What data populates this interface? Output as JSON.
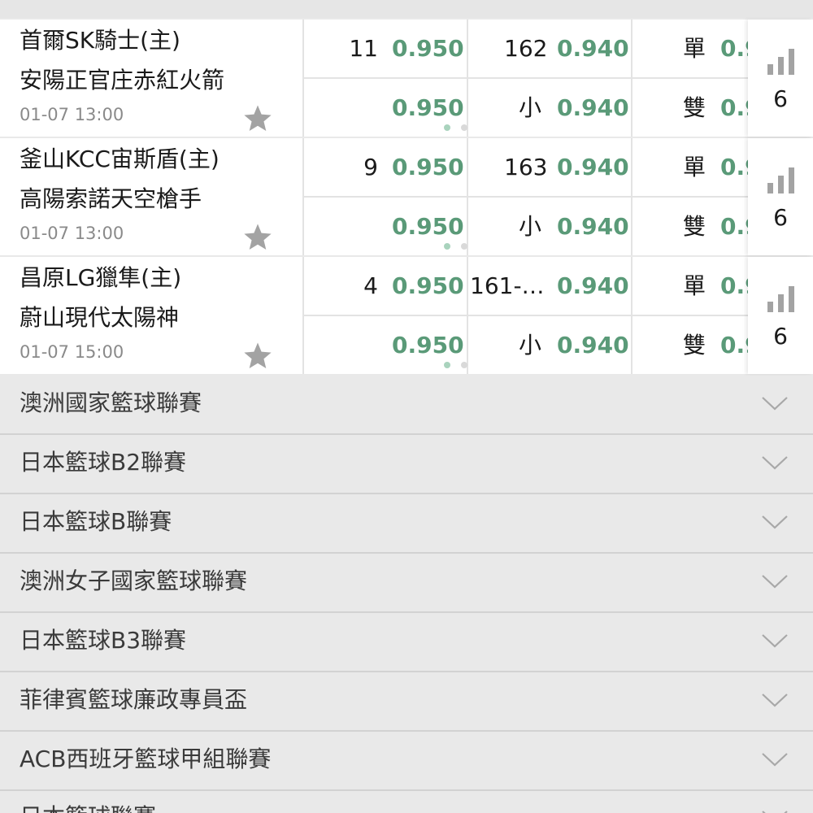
{
  "colors": {
    "odds": "#5a9a78",
    "text": "#1a1a1a",
    "muted": "#8a8a8a",
    "star": "#a3a3a3",
    "dot_active": "#a9d3bd",
    "dot_inactive": "#d9d9d9",
    "background": "#e9e9e9"
  },
  "icons": {
    "star": "star-icon",
    "signal": "signal-bars-icon",
    "chevron": "chevron-down-icon"
  },
  "matches": [
    {
      "home": "首爾SK騎士(主)",
      "away": "安陽正官庄赤紅火箭",
      "time": "01-07 13:00",
      "handicap_line": "11",
      "handicap_odds_1": "0.950",
      "handicap_odds_2": "0.950",
      "total_line": "162",
      "total_odds_1": "0.940",
      "small_label": "小",
      "total_odds_2": "0.940",
      "odd_label": "單",
      "odd_odds": "0.9",
      "even_label": "雙",
      "even_odds": "0.9",
      "more_count": "6"
    },
    {
      "home": "釜山KCC宙斯盾(主)",
      "away": "高陽索諾天空槍手",
      "time": "01-07 13:00",
      "handicap_line": "9",
      "handicap_odds_1": "0.950",
      "handicap_odds_2": "0.950",
      "total_line": "163",
      "total_odds_1": "0.940",
      "small_label": "小",
      "total_odds_2": "0.940",
      "odd_label": "單",
      "odd_odds": "0.9",
      "even_label": "雙",
      "even_odds": "0.9",
      "more_count": "6"
    },
    {
      "home": "昌原LG獵隼(主)",
      "away": "蔚山現代太陽神",
      "time": "01-07 15:00",
      "handicap_line": "4",
      "handicap_odds_1": "0.950",
      "handicap_odds_2": "0.950",
      "total_line": "161-…",
      "total_odds_1": "0.940",
      "small_label": "小",
      "total_odds_2": "0.940",
      "odd_label": "單",
      "odd_odds": "0.9",
      "even_label": "雙",
      "even_odds": "0.9",
      "more_count": "6"
    }
  ],
  "leagues": [
    "澳洲國家籃球聯賽",
    "日本籃球B2聯賽",
    "日本籃球B聯賽",
    "澳洲女子國家籃球聯賽",
    "日本籃球B3聯賽",
    "菲律賓籃球廉政專員盃",
    "ACB西班牙籃球甲組聯賽",
    "日本籃球聯賽"
  ]
}
